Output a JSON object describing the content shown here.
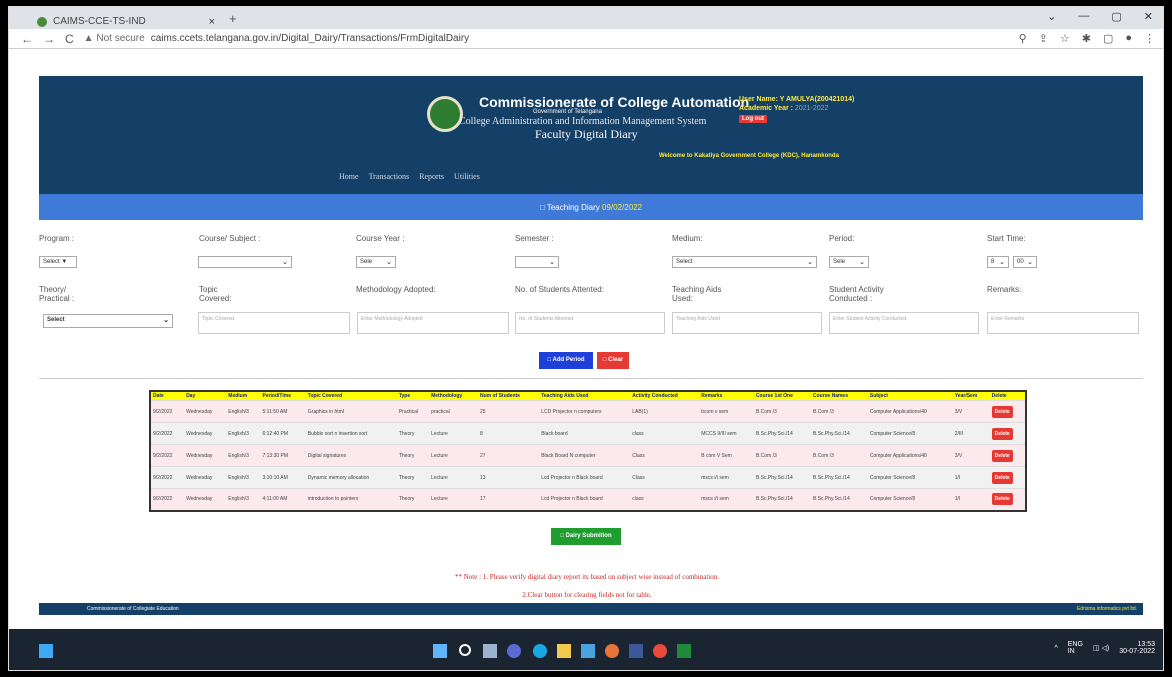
{
  "browser": {
    "tab_title": "CAIMS-CCE-TS-IND",
    "tab_close": "×",
    "new_tab": "+",
    "win_controls": [
      "⌄",
      "—",
      "▢",
      "✕"
    ],
    "nav": [
      "←",
      "→",
      "C"
    ],
    "security": "▲ Not secure",
    "url": "caims.ccets.telangana.gov.in/Digital_Dairy/Transactions/FrmDigitalDairy",
    "tools": [
      "⚲",
      "⇪",
      "☆",
      "✱",
      "▢",
      "●",
      "⋮"
    ]
  },
  "header": {
    "title": "Commissionerate of College Automation",
    "gov": "Government of Telangana",
    "subtitle": "College Administration and Information Management System",
    "faculty": "Faculty Digital Diary",
    "user": "User Name: Y AMULYA(200421014)",
    "academic_label": "Academic Year :",
    "academic_value": "2021-2022",
    "logout": "Log out",
    "welcome": "Welcome to Kakatiya Government College (KDC), Hanamkonda",
    "menu": [
      "Home",
      "Transactions",
      "Reports",
      "Utilities"
    ]
  },
  "diary": {
    "heading": "□ Teaching Diary",
    "date": "09/02/2022"
  },
  "form": {
    "labels_row1": [
      "Program :",
      "Course/ Subject :",
      "Course Year :",
      "Semester :",
      "Medium:",
      "Period:",
      "Start Time:"
    ],
    "program": "Select ▼",
    "course_year": "Sele",
    "medium": "Select",
    "period": "Sele",
    "start_hour": "8",
    "start_min": "00",
    "labels_row2": [
      "Theory/ Practical :",
      "Topic Covered:",
      "Methodology Adopted:",
      "No. of Students Attented:",
      "Teaching Aids Used:",
      "Student Activity Conducted :",
      "Remarks:"
    ],
    "theory": "Select",
    "placeholders": [
      "Topic Covered",
      "Enter Methodology Adopted",
      "No. of Students Attented",
      "Teaching Aids Used",
      "Enter Student Activity Conducted",
      "Enter Remarks"
    ],
    "add_button": "□ Add Period",
    "clear_button": "□ Clear",
    "chevron": "⌄"
  },
  "table": {
    "headers": [
      "Date",
      "Day",
      "Medium",
      "Period/Time",
      "Topic Covered",
      "Type",
      "Methodology",
      "Num of Students",
      "Teaching Aids Used",
      "Activity Conducted",
      "Remarks",
      "Course 1st One",
      "Course Names",
      "Subject",
      "Year/Sem",
      "Delete"
    ],
    "rows": [
      [
        "9/2/2022",
        "Wednesday",
        "English/3",
        "5:11:50 AM",
        "Graphics in html",
        "Practical",
        "practical",
        "25",
        "LCD Projector n computers",
        "LAB(1)",
        "bcom v sem",
        "B.Com /3",
        "B.Com /3",
        "Computer Applications/40",
        "3/V",
        "Delete"
      ],
      [
        "9/2/2022",
        "Wednesday",
        "English/3",
        "6:12:40 PM",
        "Bubble sort n insertion sort",
        "Theory",
        "Lecture",
        "8",
        "Black board",
        "class",
        "MCCS II/III sem",
        "B.Sc.Phy.Sci./14",
        "B.Sc.Phy.Sci./14",
        "Computer Science/8",
        "2/III",
        "Delete"
      ],
      [
        "9/2/2022",
        "Wednesday",
        "English/3",
        "7:13:30 PM",
        "Digital signatures",
        "Theory",
        "Lecture",
        "27",
        "Black Board N computer",
        "Class",
        "B com V Sem",
        "B.Com /3",
        "B.Com /3",
        "Computer Applications/40",
        "3/V",
        "Delete"
      ],
      [
        "9/2/2022",
        "Wednesday",
        "English/3",
        "3:10:10 AM",
        "Dynamic memory allocation",
        "Theory",
        "Lecture",
        "13",
        "Lcd Projector n Black board",
        "Class",
        "mscs i/i sem",
        "B.Sc.Phy.Sci./14",
        "B.Sc.Phy.Sci./14",
        "Computer Science/8",
        "1/I",
        "Delete"
      ],
      [
        "9/2/2022",
        "Wednesday",
        "English/3",
        "4:11:00 AM",
        "introduction to pointers",
        "Theory",
        "Lecture",
        "17",
        "Lcd Projector n Black board",
        "class",
        "mscs i/i sem",
        "B.Sc.Phy.Sci./14",
        "B.Sc.Phy.Sci./14",
        "Computer Science/8",
        "1/I",
        "Delete"
      ]
    ]
  },
  "submit": "□ Dairy Submition",
  "notes": {
    "line1": "** Note : 1. Please verify digital diary report its based on subject wise instead of combination.",
    "line2": "2.Clear button for clearing fields not for table."
  },
  "footer": {
    "left": "Commissionerate of Collegiate Education",
    "right": "Edrisma informatics pvt ltd."
  },
  "taskbar": {
    "lang": "ENG",
    "lang2": "IN",
    "time": "13:53",
    "date": "30-07-2022",
    "chevron": "^"
  },
  "colors": {
    "header_bg": "#143f66",
    "diary_bar": "#3f7ad9",
    "table_head": "#ffff00",
    "delete": "#e53935",
    "add_button": "#1e3fd8",
    "clear_button": "#e53935",
    "submit": "#1f9d2f"
  }
}
